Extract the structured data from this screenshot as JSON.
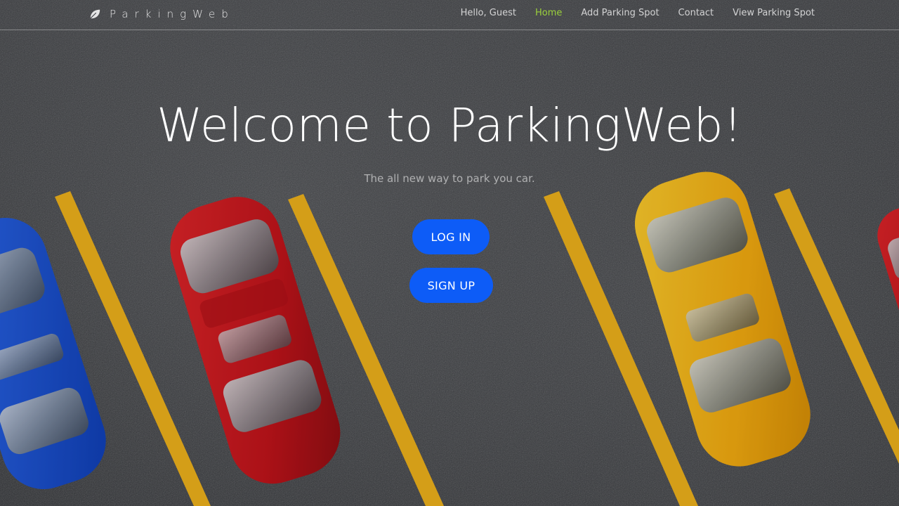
{
  "brand": {
    "name": "ParkingWeb",
    "logo_icon": "leaf-icon"
  },
  "nav": {
    "greeting": "Hello, Guest",
    "links": [
      {
        "label": "Home",
        "active": true
      },
      {
        "label": "Add Parking Spot",
        "active": false
      },
      {
        "label": "Contact",
        "active": false
      },
      {
        "label": "View Parking Spot",
        "active": false
      }
    ]
  },
  "hero": {
    "title": "Welcome to ParkingWeb!",
    "subtitle": "The all new way to park you car."
  },
  "actions": {
    "login_label": "LOG IN",
    "signup_label": "SIGN UP"
  },
  "colors": {
    "accent": "#0d5cf7",
    "nav_active": "#9bd13b",
    "lane_line": "#f2b41c",
    "asphalt": "#3a3c40"
  }
}
